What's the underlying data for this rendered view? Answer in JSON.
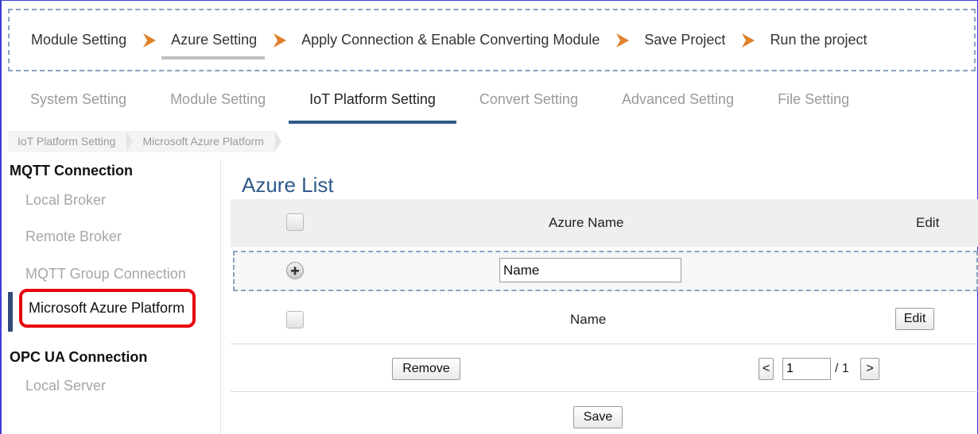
{
  "wizard": {
    "steps": [
      "Module Setting",
      "Azure Setting",
      "Apply Connection & Enable Converting Module",
      "Save Project",
      "Run the project"
    ],
    "arrow_color": "#e0822b"
  },
  "tabs": [
    "System Setting",
    "Module Setting",
    "IoT Platform Setting",
    "Convert Setting",
    "Advanced Setting",
    "File Setting"
  ],
  "breadcrumb": [
    "IoT Platform Setting",
    "Microsoft Azure Platform"
  ],
  "sidebar": {
    "mqtt_heading": "MQTT Connection",
    "mqtt_items": [
      "Local Broker",
      "Remote Broker",
      "MQTT Group Connection",
      "Microsoft Azure Platform"
    ],
    "opc_heading": "OPC UA Connection",
    "opc_items": [
      "Local Server"
    ]
  },
  "content": {
    "title": "Azure List",
    "columns": {
      "name": "Azure Name",
      "edit": "Edit"
    },
    "new_name_value": "Name",
    "rows": [
      {
        "name": "Name",
        "edit_label": "Edit"
      }
    ],
    "remove_label": "Remove",
    "pager": {
      "prev": "<",
      "page": "1",
      "total": "/ 1",
      "next": ">"
    },
    "save_label": "Save"
  },
  "colors": {
    "accent": "#2f5a8a",
    "highlight": "#e8000b"
  }
}
